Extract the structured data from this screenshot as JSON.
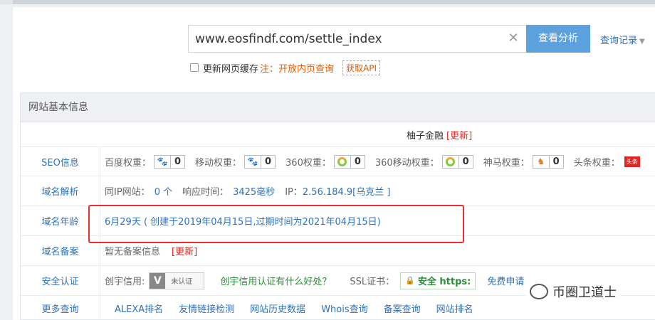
{
  "search": {
    "value": "www.eosfindf.com/settle_index",
    "button": "查看分析",
    "history": "查询记录",
    "refresh_label": "更新网页缓存",
    "note": "注：开放内页查询",
    "api": "获取API"
  },
  "basic": {
    "title": "网站基本信息",
    "site_name": "柚子金融",
    "update": "[更新]"
  },
  "seo": {
    "label": "SEO信息",
    "items": [
      {
        "name": "百度权重：",
        "icon": "paw-icon",
        "value": "0"
      },
      {
        "name": "移动权重：",
        "icon": "paw-icon",
        "value": "0"
      },
      {
        "name": "360权重：",
        "icon": "ring-icon",
        "value": "0"
      },
      {
        "name": "360移动权重：",
        "icon": "ring-icon",
        "value": "0"
      },
      {
        "name": "神马权重：",
        "icon": "horse-icon",
        "value": "0"
      },
      {
        "name": "头条权重：",
        "icon": "toutiao-icon",
        "value": "头条"
      }
    ]
  },
  "dns": {
    "label": "域名解析",
    "same_ip": "同IP网站：",
    "same_ip_value": "0 个",
    "response": "响应时间：",
    "response_value": "3425毫秒",
    "ip_label": "IP：",
    "ip_value": "2.56.184.9[乌克兰 ]"
  },
  "age": {
    "label": "域名年龄",
    "value": "6月29天 ( 创建于2019年04月15日,过期时间为2021年04月15日)"
  },
  "icp": {
    "label": "域名备案",
    "value": "暂无备案信息",
    "update": "[更新]"
  },
  "security": {
    "label": "安全认证",
    "credit": "创宇信用:",
    "cert_text": "未认证",
    "cert_letter": "V",
    "question": "创宇信用认证有什么好处？",
    "ssl_label": "SSL证书：",
    "ssl_value": "安全 https:",
    "free": "免费申请"
  },
  "more": {
    "label": "更多查询",
    "links": [
      "ALEXA排名",
      "友情链接检测",
      "网站历史数据",
      "Whois查询",
      "备案查询",
      "网站排名"
    ]
  },
  "watermark": "币圈卫道士"
}
